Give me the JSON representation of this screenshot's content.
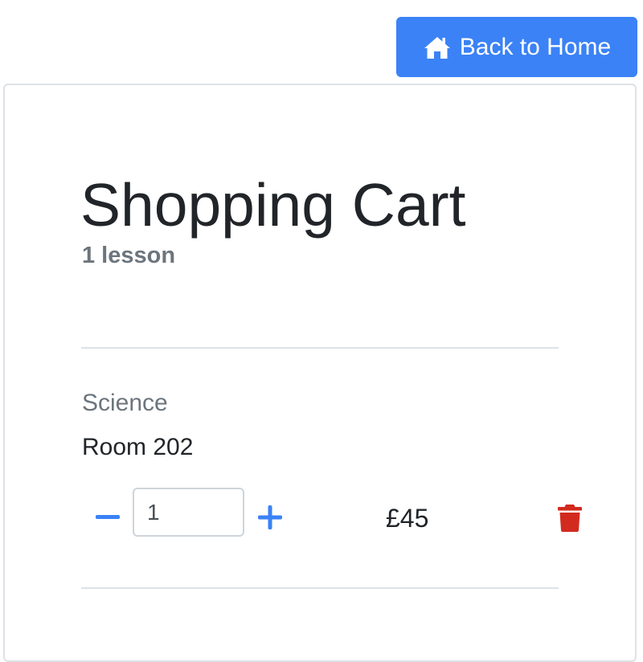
{
  "header": {
    "home_button_label": "Back to Home",
    "home_icon": "home-icon"
  },
  "cart": {
    "title": "Shopping Cart",
    "subtitle": "1 lesson"
  },
  "items": [
    {
      "category": "Science",
      "room": "Room 202",
      "quantity": "1",
      "price": "£45"
    }
  ],
  "colors": {
    "accent": "#3b82f6",
    "danger": "#d22a1e",
    "muted": "#6c757d",
    "text": "#212529",
    "border": "#dee2e6"
  }
}
